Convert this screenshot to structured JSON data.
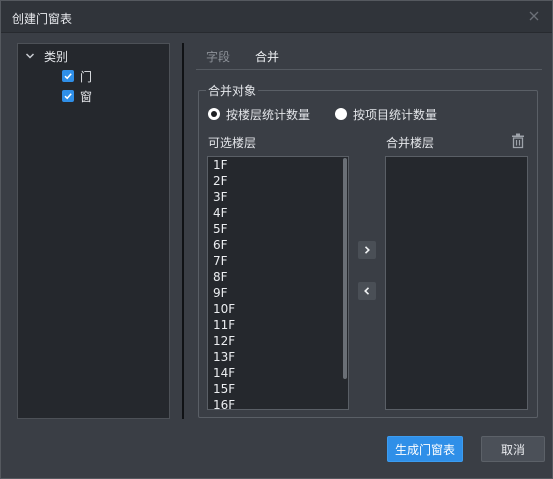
{
  "window": {
    "title": "创建门窗表"
  },
  "tree": {
    "root_label": "类别",
    "items": [
      {
        "label": "门",
        "checked": true
      },
      {
        "label": "窗",
        "checked": true
      }
    ]
  },
  "tabs": [
    {
      "label": "字段",
      "active": false
    },
    {
      "label": "合并",
      "active": true
    }
  ],
  "merge_group": {
    "title": "合并对象",
    "radio_options": [
      {
        "label": "按楼层统计数量",
        "selected": true
      },
      {
        "label": "按项目统计数量",
        "selected": false
      }
    ],
    "available_label": "可选楼层",
    "merged_label": "合并楼层",
    "available_floors": [
      "1F",
      "2F",
      "3F",
      "4F",
      "5F",
      "6F",
      "7F",
      "8F",
      "9F",
      "10F",
      "11F",
      "12F",
      "13F",
      "14F",
      "15F",
      "16F"
    ],
    "merged_floors": []
  },
  "buttons": {
    "generate": "生成门窗表",
    "cancel": "取消"
  },
  "colors": {
    "accent": "#2f8fe8",
    "dialog_bg": "#3a3e45",
    "panel_bg": "#25282d"
  }
}
